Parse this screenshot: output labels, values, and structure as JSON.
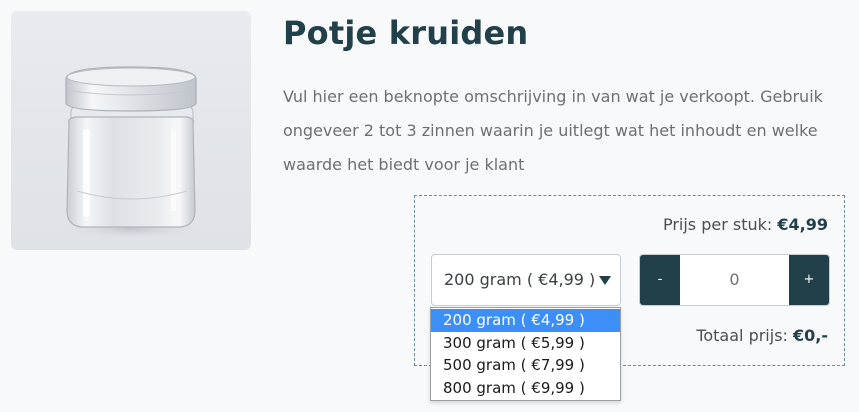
{
  "product": {
    "title": "Potje kruiden",
    "description": "Vul hier een beknopte omschrijving in van wat je verkoopt. Gebruik ongeveer 2 tot 3 zinnen waarin je uitlegt wat het inhoudt en welke waarde het biedt voor je klant",
    "image_icon": "glass-jar-photo"
  },
  "purchase": {
    "price_label": "Prijs per stuk:",
    "price_value": "€4,99",
    "variant_select": {
      "selected": "200 gram ( €4,99 )",
      "options": [
        "200 gram ( €4,99 )",
        "300 gram ( €5,99 )",
        "500 gram ( €7,99 )",
        "800 gram ( €9,99 )"
      ],
      "highlighted_index": 0
    },
    "quantity": {
      "minus_label": "-",
      "value": "0",
      "plus_label": "+"
    },
    "total_label": "Totaal prijs:",
    "total_value": "€0,-"
  },
  "colors": {
    "accent_dark": "#22404a",
    "dropdown_highlight": "#3b8ff6",
    "dashed_border": "#6a8da3"
  }
}
